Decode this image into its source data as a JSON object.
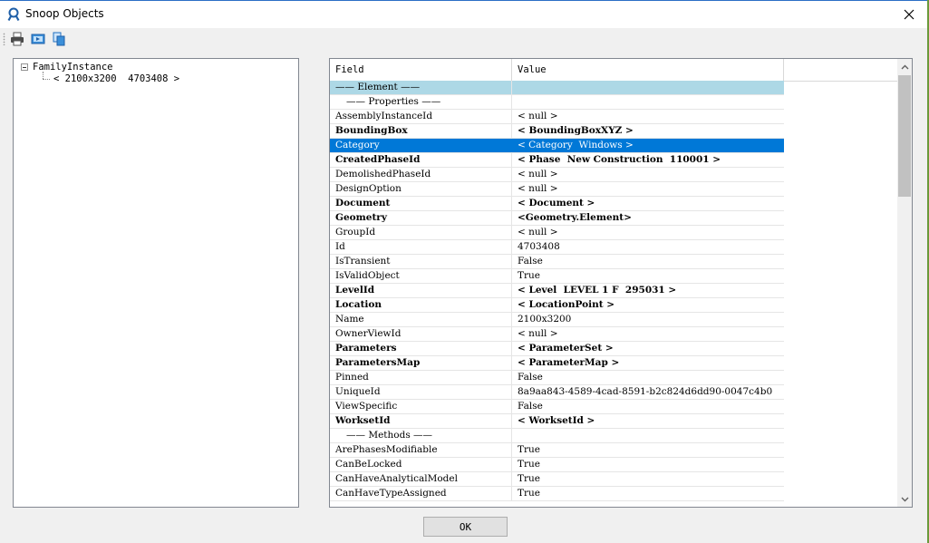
{
  "window": {
    "title": "Snoop Objects"
  },
  "toolbar": {
    "buttons": [
      {
        "icon": "printer-icon"
      },
      {
        "icon": "print-preview-icon"
      },
      {
        "icon": "copy-icon"
      }
    ]
  },
  "tree": {
    "root": "FamilyInstance",
    "child": "< 2100x3200  4703408 >"
  },
  "grid": {
    "headers": {
      "field": "Field",
      "value": "Value"
    },
    "rows": [
      {
        "field": "—— Element ——",
        "value": "",
        "kind": "section"
      },
      {
        "field": "—— Properties ——",
        "value": "",
        "kind": "sub"
      },
      {
        "field": "AssemblyInstanceId",
        "value": "< null >",
        "kind": "normal"
      },
      {
        "field": "BoundingBox",
        "value": "< BoundingBoxXYZ >",
        "kind": "bold"
      },
      {
        "field": "Category",
        "value": "< Category  Windows >",
        "kind": "selected"
      },
      {
        "field": "CreatedPhaseId",
        "value": "< Phase  New Construction  110001 >",
        "kind": "bold"
      },
      {
        "field": "DemolishedPhaseId",
        "value": "< null >",
        "kind": "normal"
      },
      {
        "field": "DesignOption",
        "value": "< null >",
        "kind": "normal"
      },
      {
        "field": "Document",
        "value": "< Document >",
        "kind": "bold"
      },
      {
        "field": "Geometry",
        "value": "<Geometry.Element>",
        "kind": "bold"
      },
      {
        "field": "GroupId",
        "value": "< null >",
        "kind": "normal"
      },
      {
        "field": "Id",
        "value": "4703408",
        "kind": "normal"
      },
      {
        "field": "IsTransient",
        "value": "False",
        "kind": "normal"
      },
      {
        "field": "IsValidObject",
        "value": "True",
        "kind": "normal"
      },
      {
        "field": "LevelId",
        "value": "< Level  LEVEL 1 F  295031 >",
        "kind": "bold"
      },
      {
        "field": "Location",
        "value": "< LocationPoint >",
        "kind": "bold"
      },
      {
        "field": "Name",
        "value": "2100x3200",
        "kind": "normal"
      },
      {
        "field": "OwnerViewId",
        "value": "< null >",
        "kind": "normal"
      },
      {
        "field": "Parameters",
        "value": "< ParameterSet >",
        "kind": "bold"
      },
      {
        "field": "ParametersMap",
        "value": "< ParameterMap >",
        "kind": "bold"
      },
      {
        "field": "Pinned",
        "value": "False",
        "kind": "normal"
      },
      {
        "field": "UniqueId",
        "value": "8a9aa843-4589-4cad-8591-b2c824d6dd90-0047c4b0",
        "kind": "normal"
      },
      {
        "field": "ViewSpecific",
        "value": "False",
        "kind": "normal"
      },
      {
        "field": "WorksetId",
        "value": "< WorksetId >",
        "kind": "bold"
      },
      {
        "field": "—— Methods ——",
        "value": "",
        "kind": "sub"
      },
      {
        "field": "ArePhasesModifiable",
        "value": "True",
        "kind": "normal"
      },
      {
        "field": "CanBeLocked",
        "value": "True",
        "kind": "normal"
      },
      {
        "field": "CanHaveAnalyticalModel",
        "value": "True",
        "kind": "normal"
      },
      {
        "field": "CanHaveTypeAssigned",
        "value": "True",
        "kind": "normal"
      }
    ]
  },
  "footer": {
    "ok_label": "OK"
  },
  "colors": {
    "selection": "#0078d7",
    "section": "#add8e6"
  }
}
